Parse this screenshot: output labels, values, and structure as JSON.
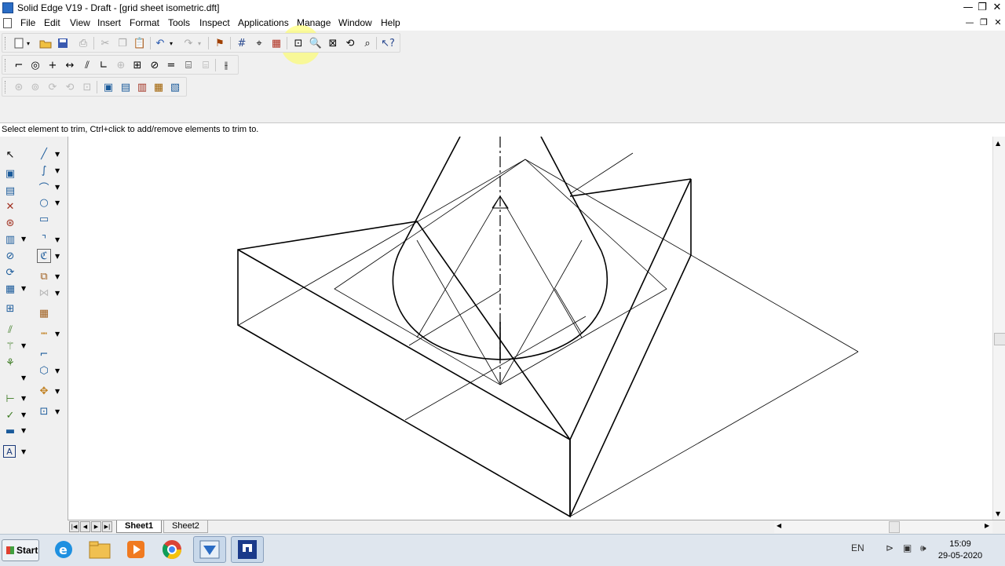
{
  "window": {
    "title": "Solid Edge V19 - Draft - [grid sheet isometric.dft]"
  },
  "menu": {
    "items": [
      "File",
      "Edit",
      "View",
      "Insert",
      "Format",
      "Tools",
      "Inspect",
      "Applications",
      "Manage",
      "Window",
      "Help"
    ]
  },
  "window_controls": {
    "minimize": "—",
    "restore": "❐",
    "close": "✕"
  },
  "prompt": {
    "text": "Select element to trim, Ctrl+click to add/remove elements to trim to."
  },
  "sheets": {
    "tab1": "Sheet1",
    "tab2": "Sheet2"
  },
  "taskbar": {
    "start_label": "Start",
    "apps": [
      "internet-explorer-icon",
      "file-explorer-icon",
      "media-player-icon",
      "chrome-icon",
      "solid-edge-icon",
      "powerpoint-icon"
    ],
    "lang": "EN",
    "time": "15:09",
    "date": "29-05-2020"
  },
  "colors": {
    "canvas": "#ffffff",
    "taskbar": "#dfe6ee",
    "highlight": "#ffff50"
  }
}
